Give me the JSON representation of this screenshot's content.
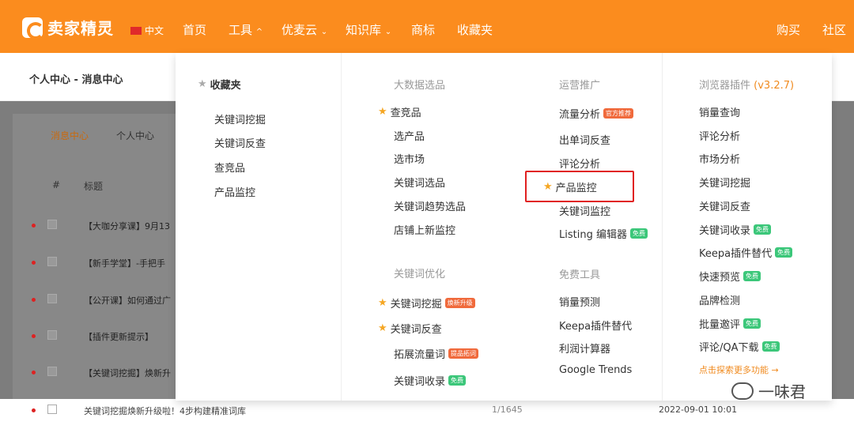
{
  "header": {
    "brand": "卖家精灵",
    "lang": "中文",
    "nav": [
      "首页",
      "工具",
      "优麦云",
      "知识库",
      "商标",
      "收藏夹"
    ],
    "right": [
      "购买",
      "社区"
    ]
  },
  "breadcrumb": "个人中心 - 消息中心",
  "tabs": [
    "消息中心",
    "个人中心"
  ],
  "table": {
    "headers": [
      "#",
      "标题"
    ],
    "rows": [
      "【大咖分享课】9月13",
      "【新手学堂】-手把手",
      "【公开课】如何通过广",
      "【插件更新提示】",
      "【关键词挖掘】焕新升"
    ],
    "last": {
      "title": "关键词挖掘焕新升级啦！4步构建精准词库",
      "pages": "1/1645",
      "time": "2022-09-01 10:01"
    }
  },
  "menu": {
    "favorites": {
      "title": "收藏夹",
      "items": [
        "关键词挖掘",
        "关键词反查",
        "查竞品",
        "产品监控"
      ]
    },
    "bigdata": {
      "title": "大数据选品",
      "items": [
        "查竞品",
        "选产品",
        "选市场",
        "关键词选品",
        "关键词趋势选品",
        "店铺上新监控"
      ]
    },
    "kwopt": {
      "title": "关键词优化",
      "items": [
        "关键词挖掘",
        "关键词反查",
        "拓展流量词",
        "关键词收录"
      ],
      "badges": [
        "焕新升级",
        "提品拓词",
        "免费"
      ]
    },
    "ops": {
      "title": "运营推广",
      "items": [
        "流量分析",
        "出单词反查",
        "评论分析",
        "产品监控",
        "关键词监控",
        "Listing 编辑器"
      ],
      "badges": [
        "官方推荐",
        "免费"
      ]
    },
    "free": {
      "title": "免费工具",
      "items": [
        "销量预测",
        "Keepa插件替代",
        "利润计算器",
        "Google Trends"
      ]
    },
    "plugin": {
      "title": "浏览器插件",
      "version": "(v3.2.7)",
      "items": [
        "销量查询",
        "评论分析",
        "市场分析",
        "关键词挖掘",
        "关键词反查",
        "关键词收录",
        "Keepa插件替代",
        "快速预览",
        "品牌检测",
        "批量邀评",
        "评论/QA下载"
      ],
      "badge": "免费",
      "more": "点击探索更多功能 →"
    }
  },
  "watermark": "一味君"
}
